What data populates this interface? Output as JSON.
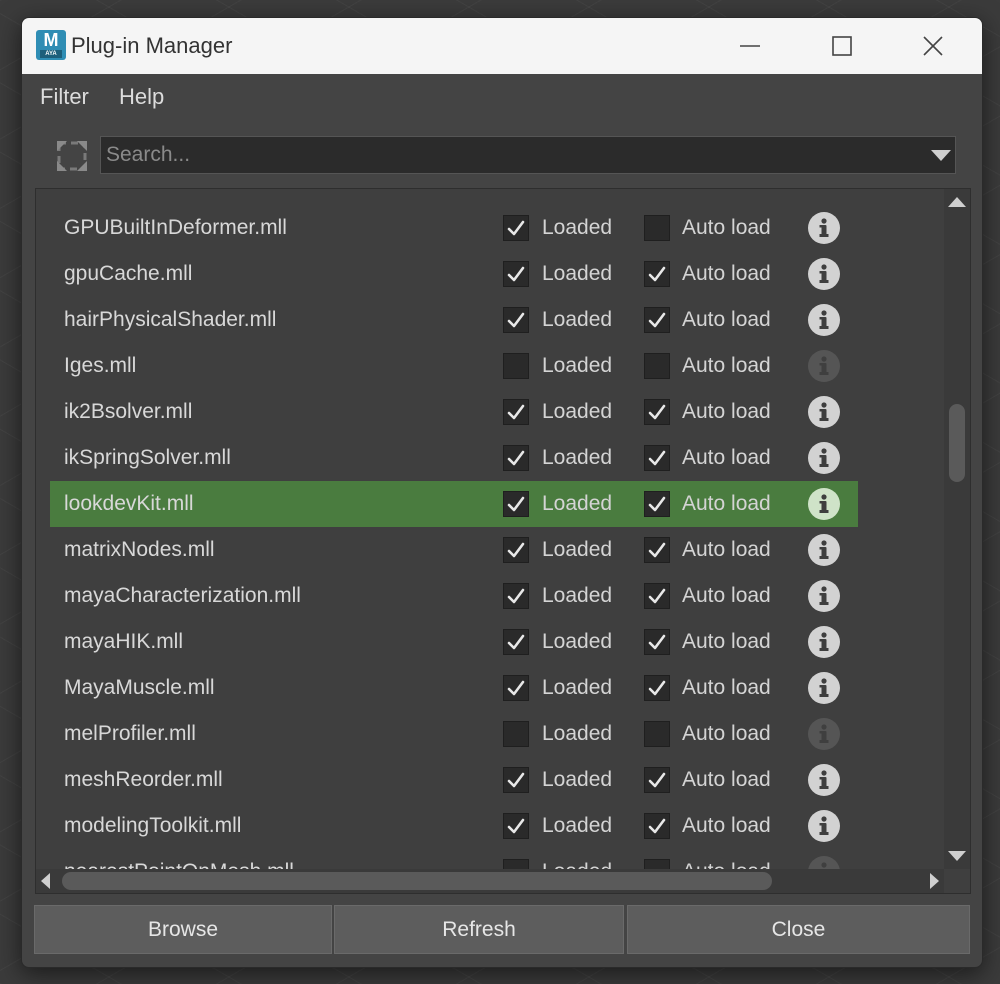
{
  "window": {
    "title": "Plug-in Manager",
    "logo_letter": "M",
    "logo_sub": "AYA"
  },
  "menu": {
    "filter": "Filter",
    "help": "Help"
  },
  "search": {
    "placeholder": "Search...",
    "value": ""
  },
  "columns": {
    "loaded_label": "Loaded",
    "autoload_label": "Auto load"
  },
  "colors": {
    "selected_row": "#4a7c3f",
    "window_bg": "#444444",
    "titlebar_bg": "#f5f5f5"
  },
  "plugins": [
    {
      "name": "GPUBuiltInDeformer.mll",
      "loaded": true,
      "autoload": false,
      "selected": false
    },
    {
      "name": "gpuCache.mll",
      "loaded": true,
      "autoload": true,
      "selected": false
    },
    {
      "name": "hairPhysicalShader.mll",
      "loaded": true,
      "autoload": true,
      "selected": false
    },
    {
      "name": "Iges.mll",
      "loaded": false,
      "autoload": false,
      "selected": false
    },
    {
      "name": "ik2Bsolver.mll",
      "loaded": true,
      "autoload": true,
      "selected": false
    },
    {
      "name": "ikSpringSolver.mll",
      "loaded": true,
      "autoload": true,
      "selected": false
    },
    {
      "name": "lookdevKit.mll",
      "loaded": true,
      "autoload": true,
      "selected": true
    },
    {
      "name": "matrixNodes.mll",
      "loaded": true,
      "autoload": true,
      "selected": false
    },
    {
      "name": "mayaCharacterization.mll",
      "loaded": true,
      "autoload": true,
      "selected": false
    },
    {
      "name": "mayaHIK.mll",
      "loaded": true,
      "autoload": true,
      "selected": false
    },
    {
      "name": "MayaMuscle.mll",
      "loaded": true,
      "autoload": true,
      "selected": false
    },
    {
      "name": "melProfiler.mll",
      "loaded": false,
      "autoload": false,
      "selected": false
    },
    {
      "name": "meshReorder.mll",
      "loaded": true,
      "autoload": true,
      "selected": false
    },
    {
      "name": "modelingToolkit.mll",
      "loaded": true,
      "autoload": true,
      "selected": false
    },
    {
      "name": "nearestPointOnMesh.mll",
      "loaded": false,
      "autoload": false,
      "selected": false
    }
  ],
  "buttons": {
    "browse": "Browse",
    "refresh": "Refresh",
    "close": "Close"
  },
  "icons": {
    "app": "maya-logo-icon",
    "filter": "filter-icon",
    "info": "info-icon",
    "minimize": "minimize-icon",
    "maximize": "maximize-icon",
    "close": "close-icon"
  }
}
